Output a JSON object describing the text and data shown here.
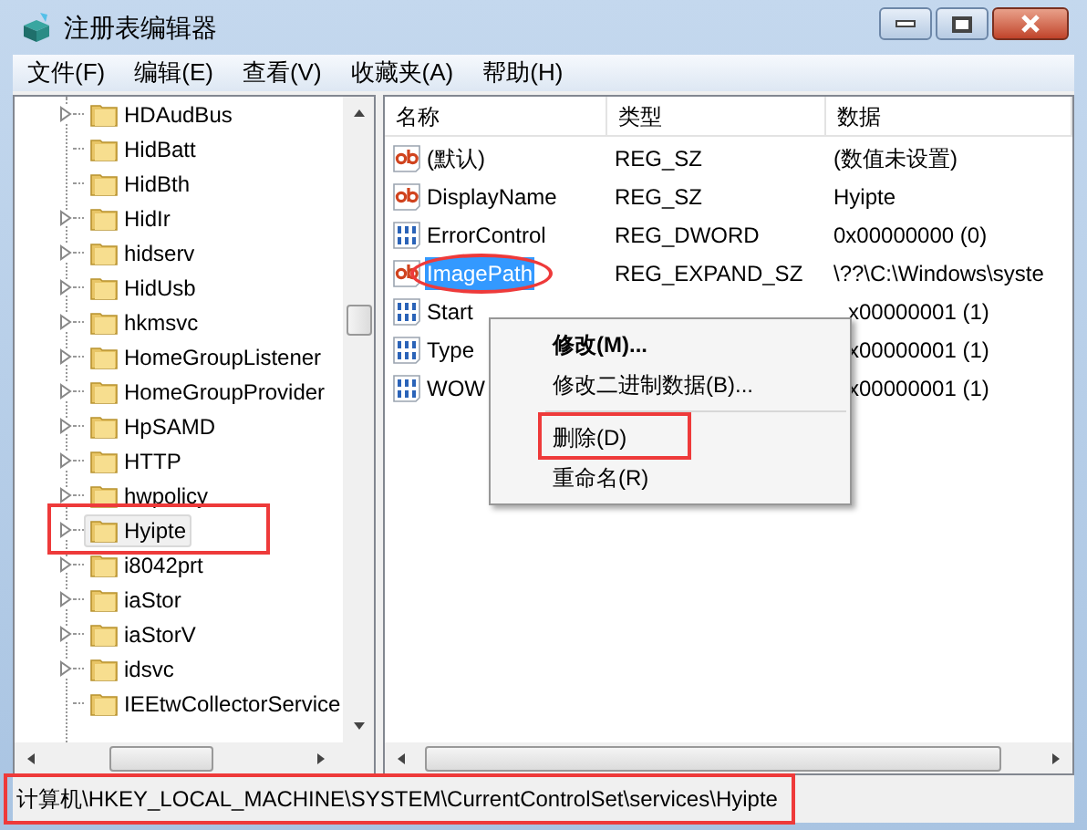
{
  "window": {
    "title": "注册表编辑器"
  },
  "menu": [
    "文件(F)",
    "编辑(E)",
    "查看(V)",
    "收藏夹(A)",
    "帮助(H)"
  ],
  "tree": {
    "items": [
      {
        "label": "HDAudBus",
        "expandable": true,
        "selected": false,
        "annotated": false
      },
      {
        "label": "HidBatt",
        "expandable": false,
        "selected": false,
        "annotated": false
      },
      {
        "label": "HidBth",
        "expandable": false,
        "selected": false,
        "annotated": false
      },
      {
        "label": "HidIr",
        "expandable": true,
        "selected": false,
        "annotated": false
      },
      {
        "label": "hidserv",
        "expandable": true,
        "selected": false,
        "annotated": false
      },
      {
        "label": "HidUsb",
        "expandable": true,
        "selected": false,
        "annotated": false
      },
      {
        "label": "hkmsvc",
        "expandable": true,
        "selected": false,
        "annotated": false
      },
      {
        "label": "HomeGroupListener",
        "expandable": true,
        "selected": false,
        "annotated": false
      },
      {
        "label": "HomeGroupProvider",
        "expandable": true,
        "selected": false,
        "annotated": false
      },
      {
        "label": "HpSAMD",
        "expandable": true,
        "selected": false,
        "annotated": false
      },
      {
        "label": "HTTP",
        "expandable": true,
        "selected": false,
        "annotated": false
      },
      {
        "label": "hwpolicy",
        "expandable": true,
        "selected": false,
        "annotated": false
      },
      {
        "label": "Hyipte",
        "expandable": true,
        "selected": true,
        "annotated": true
      },
      {
        "label": "i8042prt",
        "expandable": true,
        "selected": false,
        "annotated": false
      },
      {
        "label": "iaStor",
        "expandable": true,
        "selected": false,
        "annotated": false
      },
      {
        "label": "iaStorV",
        "expandable": true,
        "selected": false,
        "annotated": false
      },
      {
        "label": "idsvc",
        "expandable": true,
        "selected": false,
        "annotated": false
      },
      {
        "label": "IEEtwCollectorService",
        "expandable": false,
        "selected": false,
        "annotated": false
      }
    ]
  },
  "values": {
    "columns": [
      "名称",
      "类型",
      "数据"
    ],
    "rows": [
      {
        "kind": "string",
        "name": "(默认)",
        "type": "REG_SZ",
        "data": "(数值未设置)",
        "selected": false,
        "annotated": false
      },
      {
        "kind": "string",
        "name": "DisplayName",
        "type": "REG_SZ",
        "data": "Hyipte",
        "selected": false,
        "annotated": false
      },
      {
        "kind": "binary",
        "name": "ErrorControl",
        "type": "REG_DWORD",
        "data": "0x00000000 (0)",
        "selected": false,
        "annotated": false
      },
      {
        "kind": "string",
        "name": "ImagePath",
        "type": "REG_EXPAND_SZ",
        "data": "\\??\\C:\\Windows\\syste",
        "selected": true,
        "annotated": true
      },
      {
        "kind": "binary",
        "name": "Start",
        "data": "x00000001 (1)",
        "selected": false,
        "annotated": false
      },
      {
        "kind": "binary",
        "name": "Type",
        "data": "x00000001 (1)",
        "selected": false,
        "annotated": false
      },
      {
        "kind": "binary",
        "name": "WOW",
        "data": "x00000001 (1)",
        "selected": false,
        "annotated": false
      }
    ]
  },
  "context_menu": {
    "items": [
      {
        "kind": "item",
        "label": "修改(M)...",
        "default": true,
        "annotated": false
      },
      {
        "kind": "item",
        "label": "修改二进制数据(B)...",
        "default": false,
        "annotated": false
      },
      {
        "kind": "separator"
      },
      {
        "kind": "item",
        "label": "删除(D)",
        "default": false,
        "annotated": true
      },
      {
        "kind": "item",
        "label": "重命名(R)",
        "default": false,
        "annotated": false
      }
    ]
  },
  "status_bar": {
    "path": "计算机\\HKEY_LOCAL_MACHINE\\SYSTEM\\CurrentControlSet\\services\\Hyipte",
    "annotated": true
  }
}
